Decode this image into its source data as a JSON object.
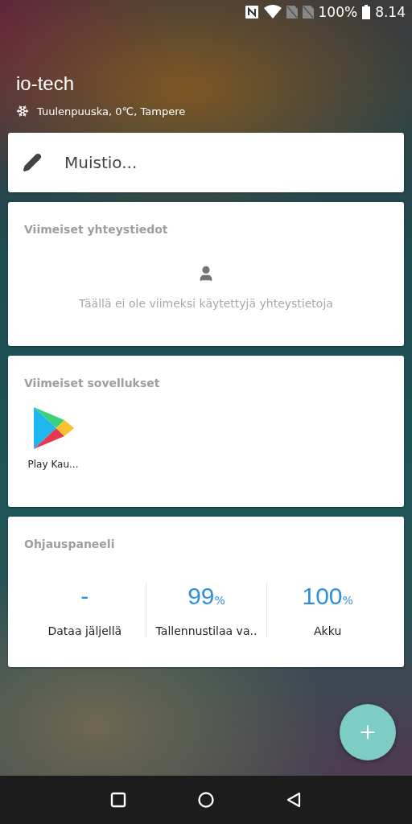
{
  "status_bar": {
    "battery": "100%",
    "time": "8.14"
  },
  "header": {
    "title": "io-tech",
    "weather": "Tuulenpuuska, 0℃, Tampere"
  },
  "notes": {
    "placeholder": "Muistio..."
  },
  "contacts": {
    "title": "Viimeiset yhteystiedot",
    "empty_text": "Täällä ei ole viimeksi käytettyjä yhteystietoja"
  },
  "apps": {
    "title": "Viimeiset sovellukset",
    "items": [
      {
        "label": "Play Kau..."
      }
    ]
  },
  "dashboard": {
    "title": "Ohjauspaneeli",
    "stats": [
      {
        "value": "-",
        "label": "Dataa jäljellä"
      },
      {
        "value": "99",
        "unit": "%",
        "label": "Tallennustilaa va.."
      },
      {
        "value": "100",
        "unit": "%",
        "label": "Akku"
      }
    ]
  }
}
